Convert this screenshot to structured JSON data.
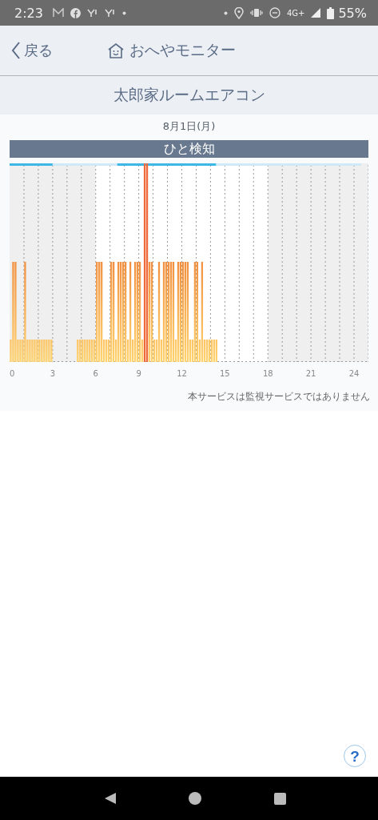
{
  "status_bar": {
    "time": "2:23",
    "network": "4G+",
    "battery": "55%"
  },
  "header": {
    "back": "戻る",
    "title": "おへやモニター"
  },
  "device_name": "太郎家ルームエアコン",
  "date": "8月1日(月)",
  "section_title": "ひと検知",
  "x_axis_labels": [
    "0",
    "3",
    "6",
    "9",
    "12",
    "15",
    "18",
    "21",
    "24"
  ],
  "disclaimer": "本サービスは監視サービスではありません",
  "help_button": "?"
}
